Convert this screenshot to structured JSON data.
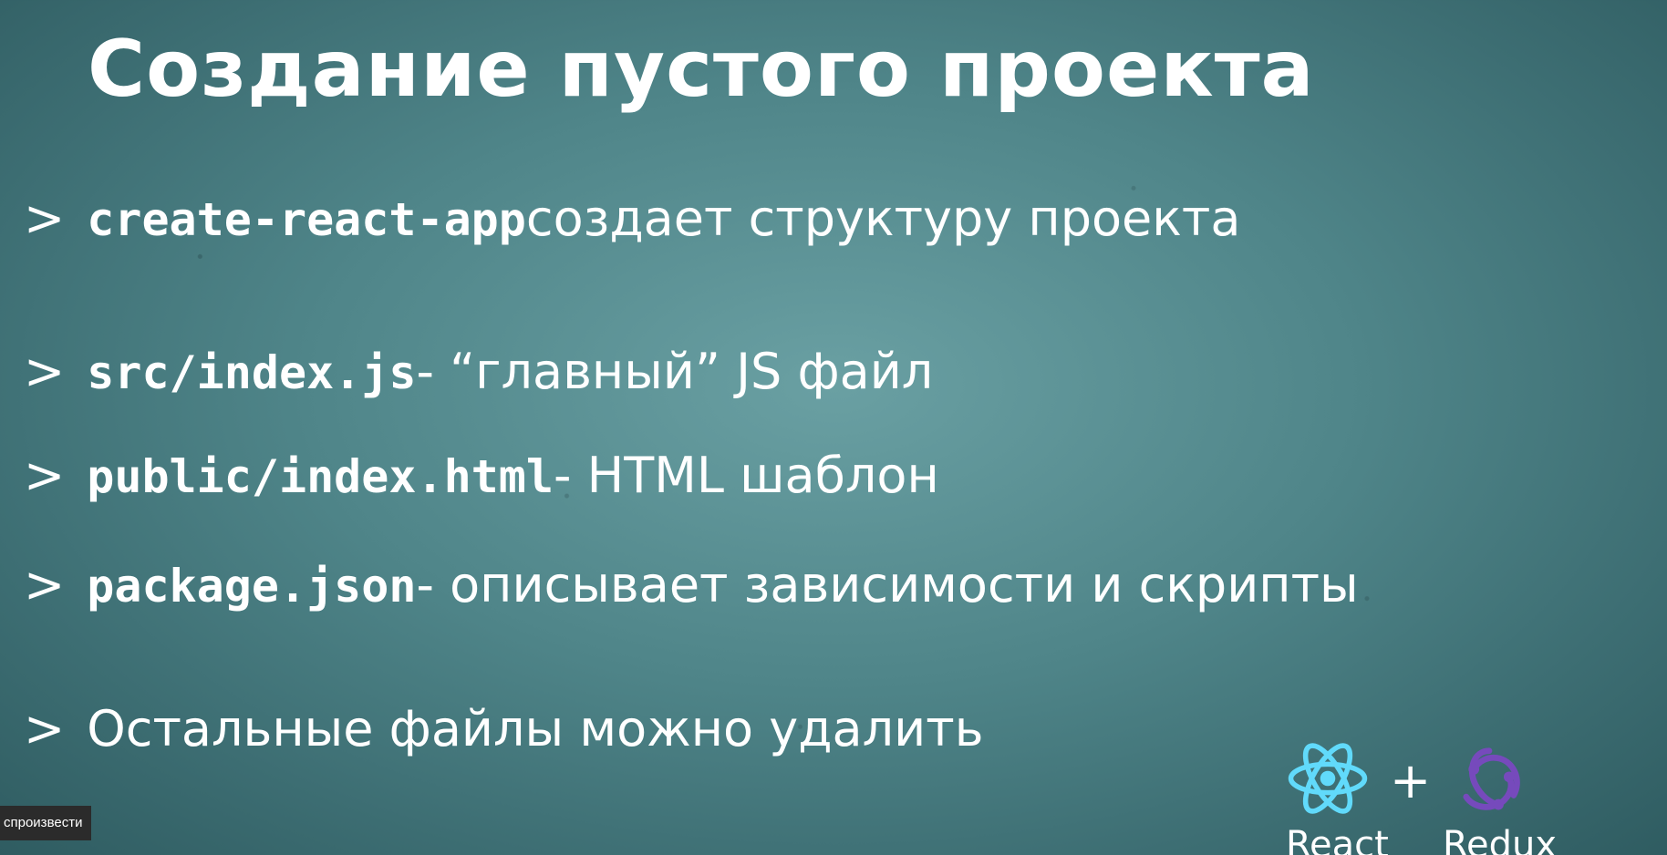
{
  "slide": {
    "title": "Создание пустого проекта",
    "bullet_marker": ">",
    "bullets": [
      {
        "code": "create-react-app",
        "text": " создает структуру проекта"
      },
      {
        "code": "src/index.js",
        "text": " - “главный” JS файл"
      },
      {
        "code": "public/index.html",
        "text": " - HTML шаблон"
      },
      {
        "code": "package.json",
        "text": " - описывает зависимости и скрипты"
      },
      {
        "code": "",
        "text": "Остальные файлы можно удалить"
      }
    ]
  },
  "logos": {
    "plus": "+",
    "react_label": "React",
    "redux_label": "Redux",
    "react_color": "#61dafb",
    "redux_color": "#764abc"
  },
  "tooltip": {
    "text": "спроизвести"
  }
}
